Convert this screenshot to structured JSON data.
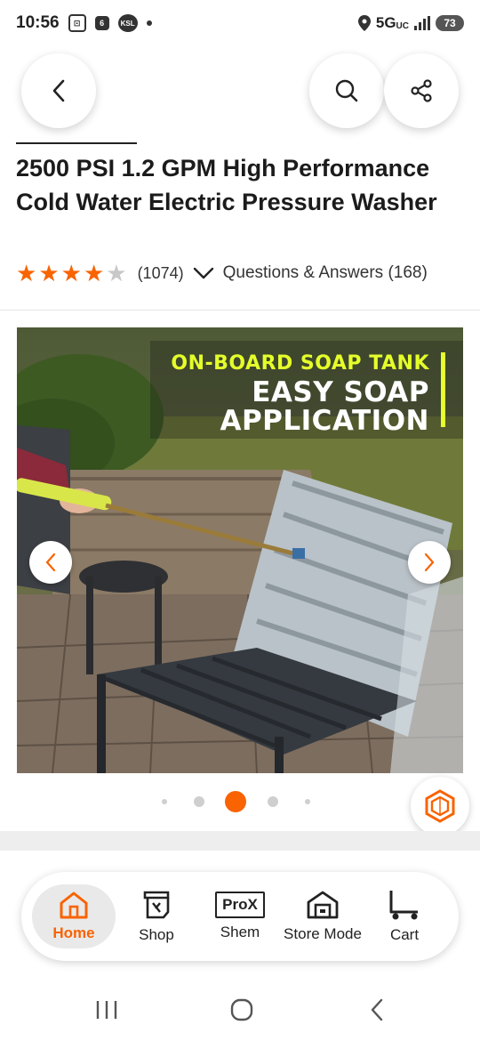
{
  "status_bar": {
    "time": "10:56",
    "icon_a": "⊡",
    "icon_b": "6",
    "icon_c": "KSL",
    "network": "5G",
    "network_sub": "UC",
    "battery": "73"
  },
  "product": {
    "title": "2500 PSI 1.2 GPM High Performance Cold Water Electric Pressure Washer",
    "rating": 4,
    "rating_max": 5,
    "review_count": "(1074)",
    "qa_label": "Questions & Answers (168)"
  },
  "image": {
    "line1": "ON-BOARD SOAP TANK",
    "line2": "EASY SOAP",
    "line3": "APPLICATION"
  },
  "carousel": {
    "dot_count": 5,
    "active_index": 2
  },
  "bottom_nav": {
    "items": [
      {
        "label": "Home",
        "icon": "home-icon",
        "active": true
      },
      {
        "label": "Shop",
        "icon": "shop-icon"
      },
      {
        "label": "Shem",
        "icon": "prox-icon",
        "badge": "ProX"
      },
      {
        "label": "Store Mode",
        "icon": "store-icon"
      },
      {
        "label": "Cart",
        "icon": "cart-icon"
      }
    ]
  },
  "colors": {
    "accent": "#f96302",
    "star_empty": "#c8c8c8",
    "image_highlight": "#e5ff2a"
  }
}
